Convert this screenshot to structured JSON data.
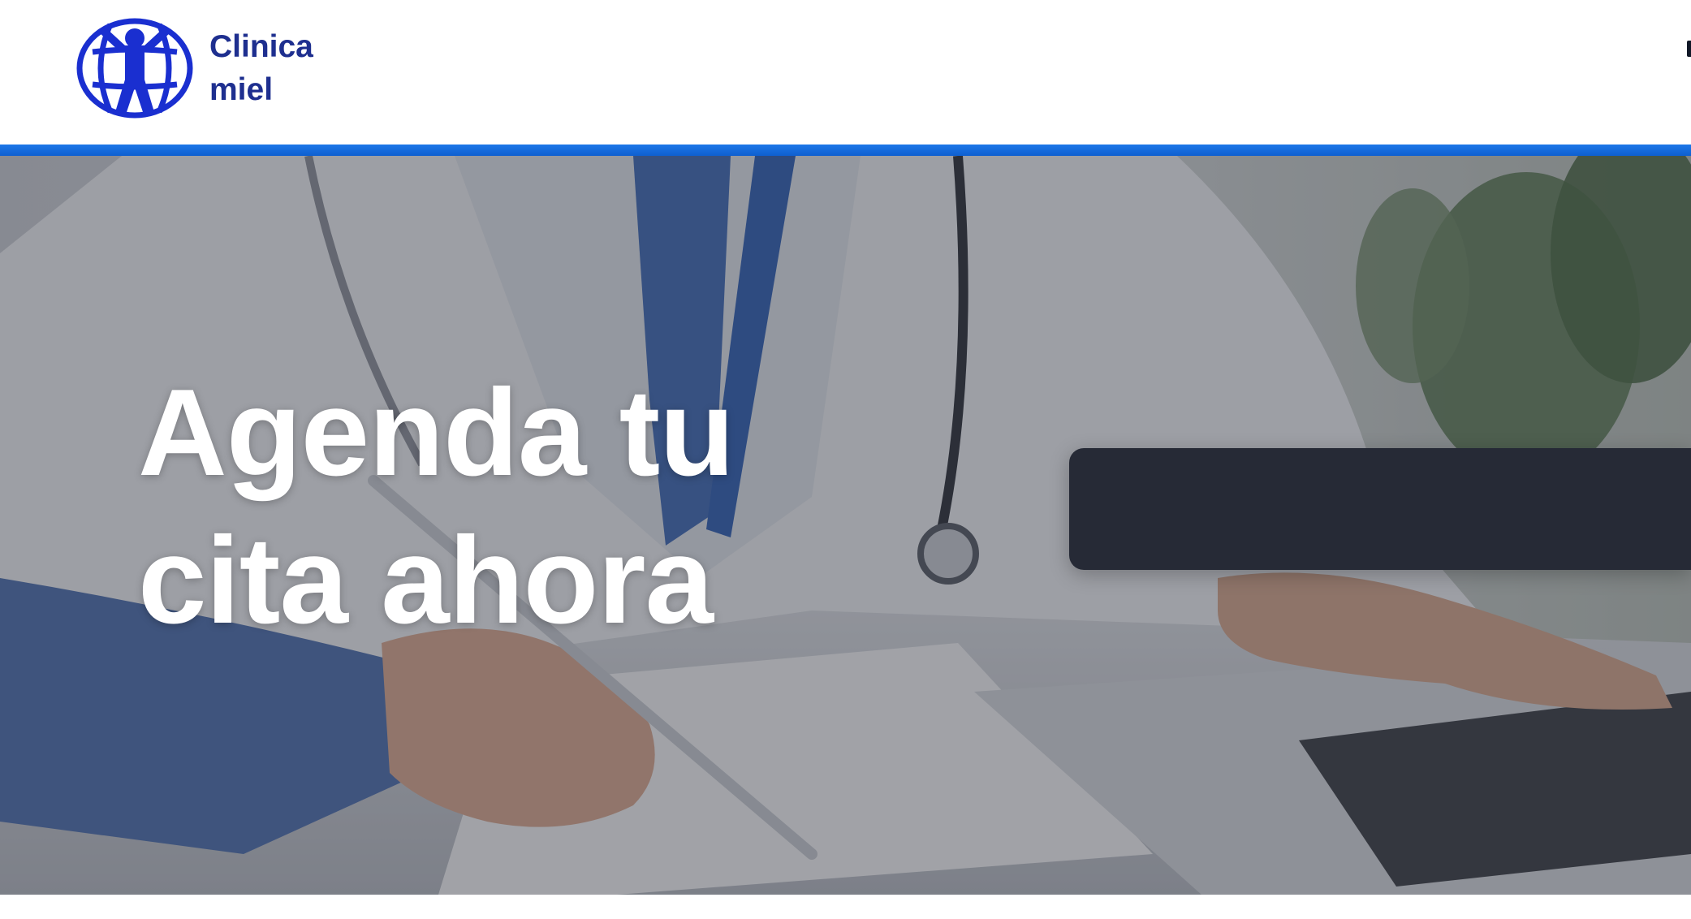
{
  "brand": {
    "name_line1": "Clinica",
    "name_line2": "miel",
    "logo_icon": "globe-person-icon",
    "color": "#1e2f8f"
  },
  "accent_color": "#1d77e8",
  "hero": {
    "title_line1": "Agenda tu",
    "title_line2": "cita ahora",
    "background_icon": "doctor-at-desk-photo",
    "panel_color": "#262a36"
  }
}
